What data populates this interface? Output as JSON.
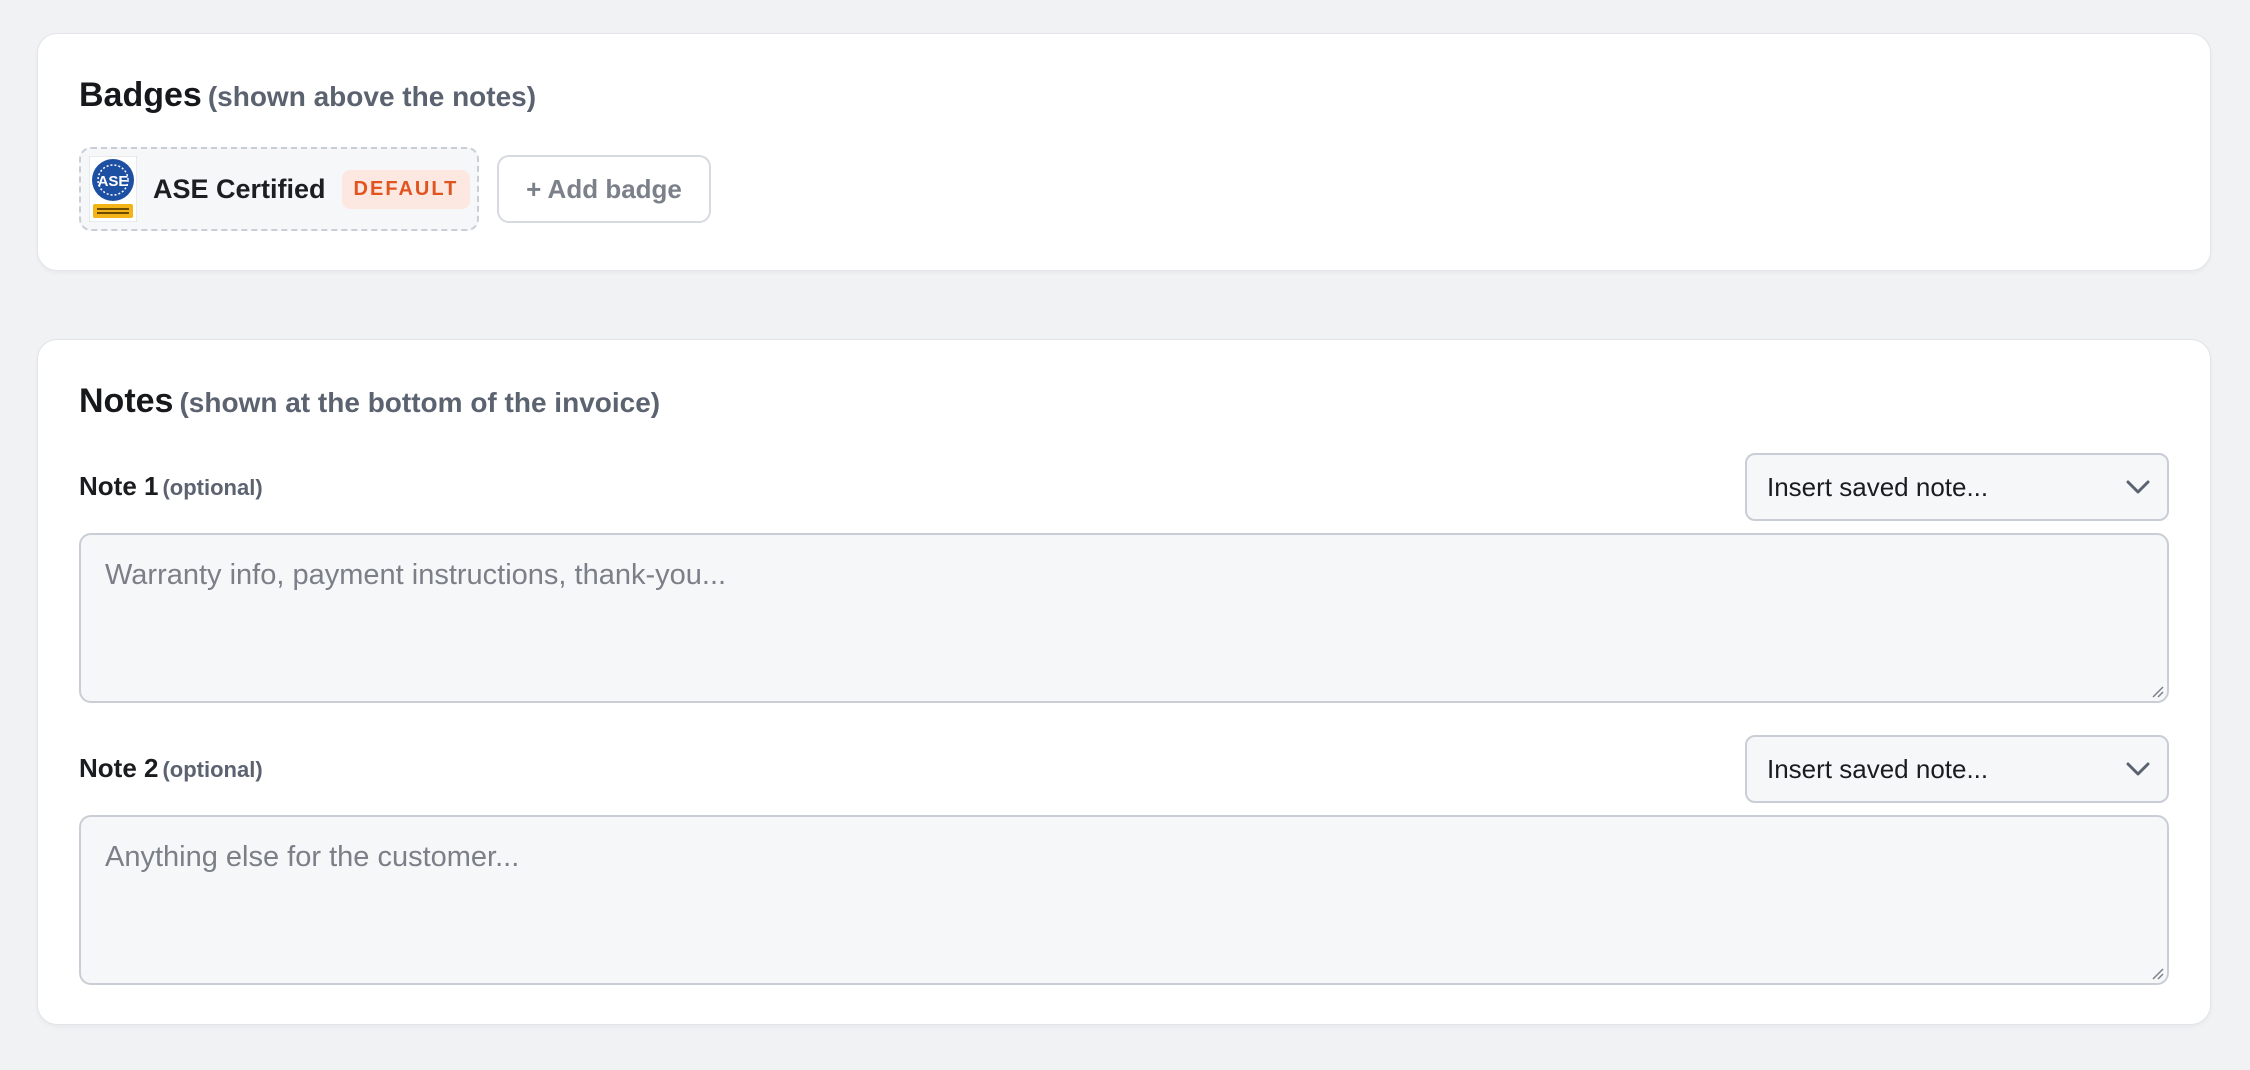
{
  "badges": {
    "title": "Badges",
    "subtitle": "(shown above the notes)",
    "items": [
      {
        "name": "ASE Certified",
        "tag": "DEFAULT",
        "logo_text": "ASE",
        "logo_icon": "ase-certified-logo"
      }
    ],
    "add_label": "+ Add badge"
  },
  "notes": {
    "title": "Notes",
    "subtitle": "(shown at the bottom of the invoice)",
    "fields": [
      {
        "label": "Note 1",
        "optional": "(optional)",
        "select_value": "Insert saved note...",
        "value": "",
        "placeholder": "Warranty info, payment instructions, thank-you..."
      },
      {
        "label": "Note 2",
        "optional": "(optional)",
        "select_value": "Insert saved note...",
        "value": "",
        "placeholder": "Anything else for the customer..."
      }
    ]
  },
  "colors": {
    "page_bg": "#f1f2f4",
    "card_bg": "#ffffff",
    "default_tag_text": "#e0551f",
    "default_tag_bg": "#fde8e1",
    "logo_blue": "#1d4fa3",
    "logo_gold": "#f2b417"
  }
}
